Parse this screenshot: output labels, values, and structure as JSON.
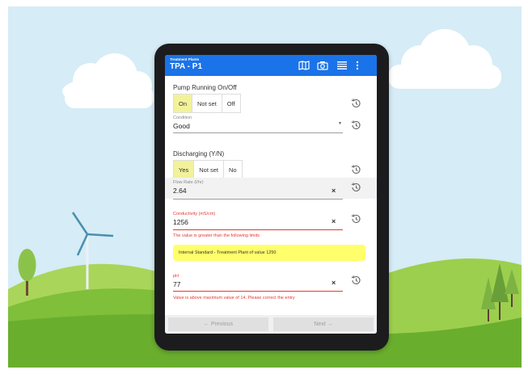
{
  "app": {
    "subtitle": "Treatment Plants",
    "title": "TPA - P1",
    "icons": [
      "map-icon",
      "camera-icon",
      "barcode-icon",
      "more-vert-icon"
    ]
  },
  "pump": {
    "label": "Pump Running On/Off",
    "options": [
      "On",
      "Not set",
      "Off"
    ],
    "selected": "On"
  },
  "condition": {
    "label": "Condition",
    "value": "Good"
  },
  "discharging": {
    "label": "Discharging (Y/N)",
    "options": [
      "Yes",
      "Not set",
      "No"
    ],
    "selected": "Yes"
  },
  "flow_rate": {
    "label": "Flow Rate (l/hr)",
    "value": "2.64",
    "clear": "×"
  },
  "conductivity": {
    "label": "Conductivity (mS/cm)",
    "value": "1256",
    "clear": "×",
    "error": "The value is greater than the following limits",
    "limit_note": "Internal Standard - Treatment Plant of value 1250"
  },
  "ph": {
    "label": "pH",
    "value": "77",
    "clear": "×",
    "error": "Value is above maximum value of 14. Please correct the entry"
  },
  "nav": {
    "previous": "← Previous",
    "next": "Next →"
  },
  "colors": {
    "appbar": "#1a73e8",
    "selected": "#f2f29a",
    "error": "#e53935",
    "note": "#ffff6b"
  }
}
